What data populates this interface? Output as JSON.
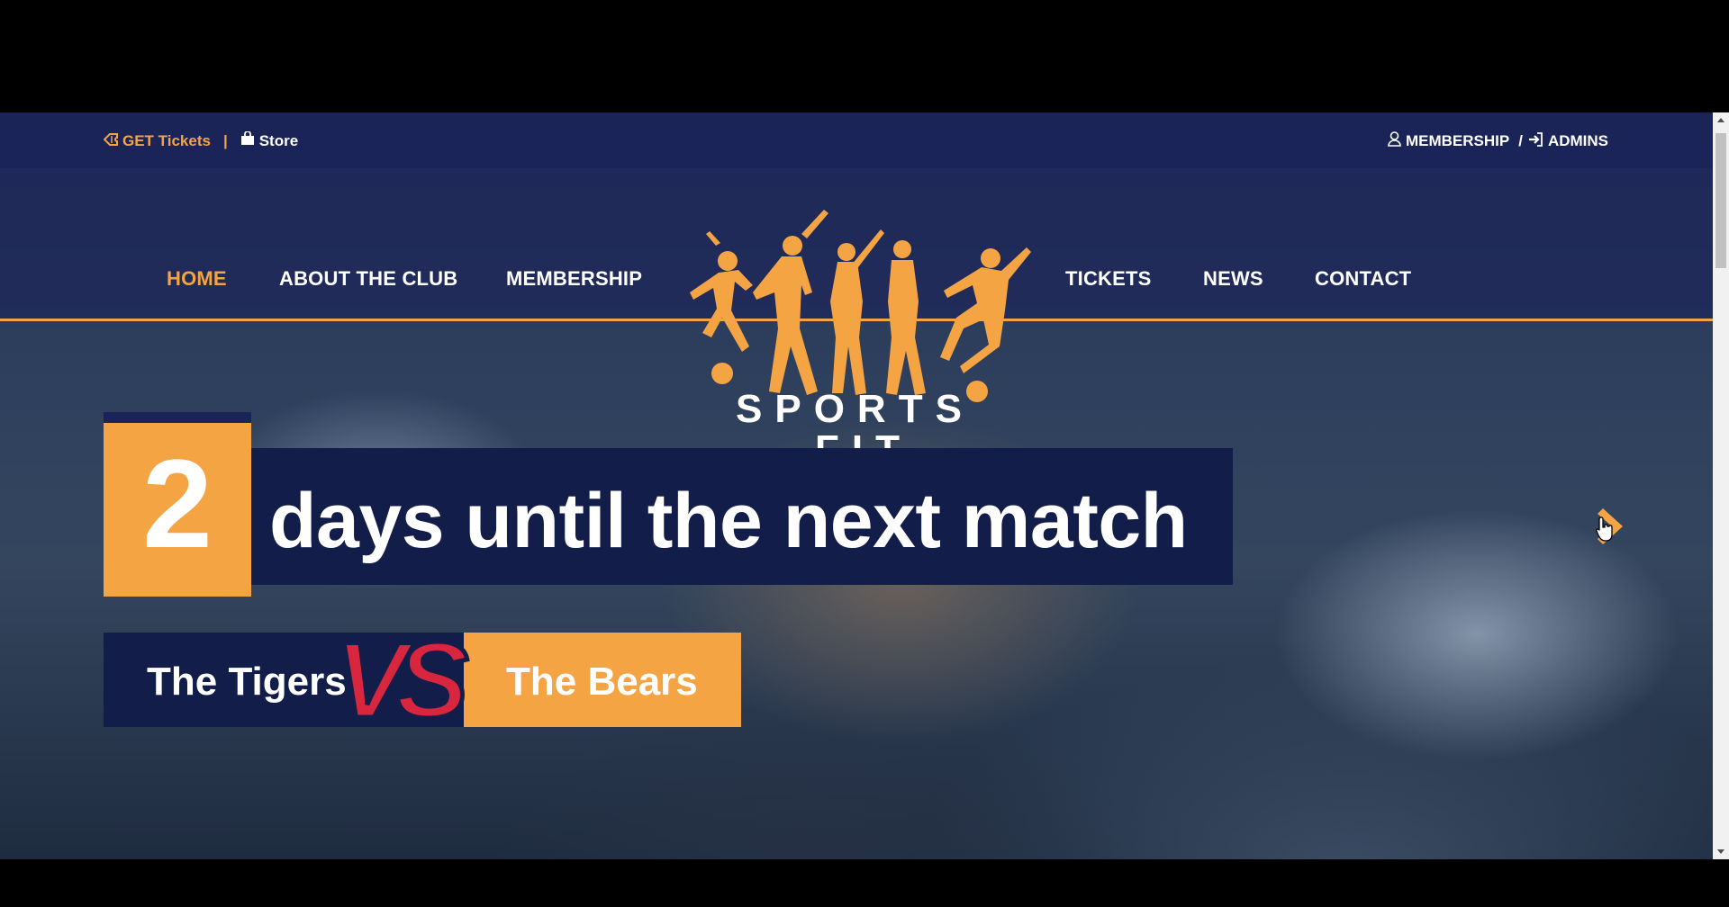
{
  "topbar": {
    "tickets_label": "GET Tickets",
    "separator": "|",
    "store_label": "Store",
    "membership_label": "MEMBERSHIP",
    "slash": "/",
    "admins_label": "ADMINS"
  },
  "nav": {
    "items": [
      {
        "label": "HOME",
        "active": true
      },
      {
        "label": "ABOUT THE CLUB",
        "active": false
      },
      {
        "label": "MEMBERSHIP",
        "active": false
      },
      {
        "label": "TICKETS",
        "active": false
      },
      {
        "label": "NEWS",
        "active": false
      },
      {
        "label": "CONTACT",
        "active": false
      }
    ]
  },
  "logo": {
    "line1": "SPORTS",
    "line2": "FIT"
  },
  "hero": {
    "countdown_number": "2",
    "countdown_text": "days until the next match",
    "team_home": "The Tigers",
    "versus": "VS",
    "team_away": "The Bears"
  },
  "colors": {
    "accent": "#f5a444",
    "navy": "#1a2458",
    "dark_navy": "#131d4a",
    "versus_red": "#d7263d"
  },
  "icons": {
    "tickets": "ticket-icon",
    "store": "shopping-bag-icon",
    "membership": "user-icon",
    "admins": "sign-in-icon",
    "next": "arrow-right-icon"
  }
}
